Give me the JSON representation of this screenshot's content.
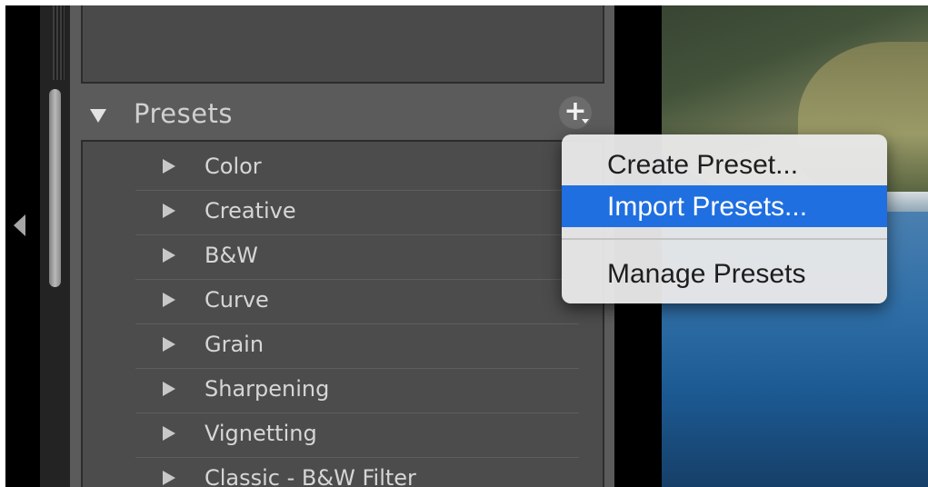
{
  "panel": {
    "title": "Presets",
    "add_button_label": "+"
  },
  "preset_groups": [
    "Color",
    "Creative",
    "B&W",
    "Curve",
    "Grain",
    "Sharpening",
    "Vignetting",
    "Classic - B&W Filter"
  ],
  "menu": {
    "items": [
      {
        "label": "Create Preset..."
      },
      {
        "label": "Import Presets..."
      },
      {
        "label": "Manage Presets"
      }
    ],
    "selected_index": 1
  },
  "colors": {
    "accent_selected": "#1f6fe0",
    "panel_bg": "#5b5b5b"
  },
  "icons": {
    "collapse": "caret-left-icon",
    "section": "disclosure-down-icon",
    "group": "disclosure-right-icon"
  }
}
